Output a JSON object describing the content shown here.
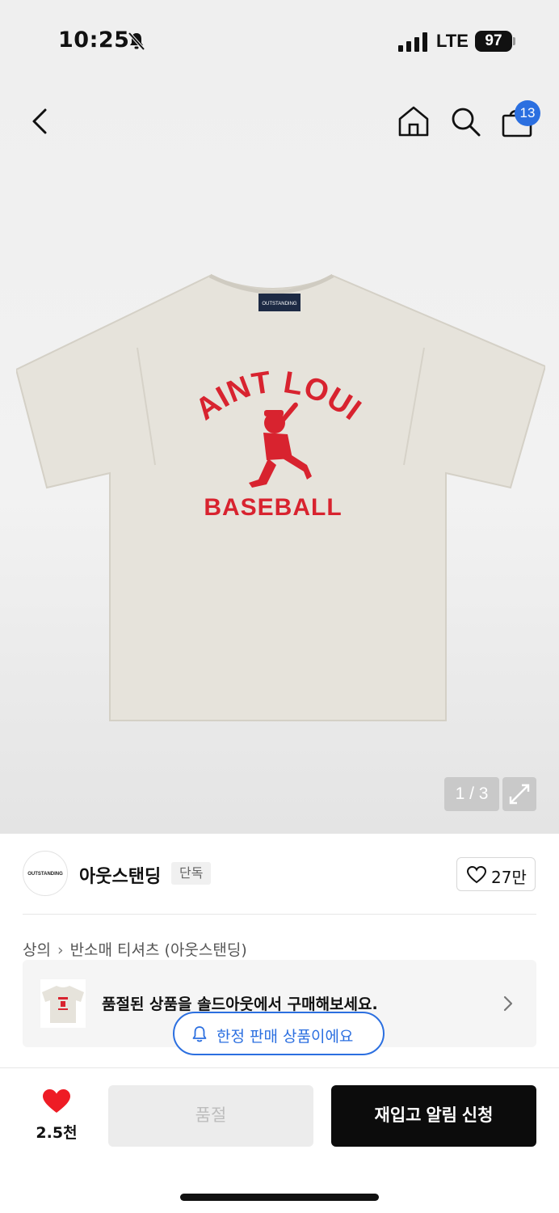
{
  "status_bar": {
    "time": "10:25",
    "network": "LTE",
    "battery": "97"
  },
  "nav": {
    "cart_count": "13"
  },
  "product_image": {
    "print_top": "SAINT LOUIS",
    "print_bottom": "BASEBALL",
    "label_text": "OUTSTANDING",
    "shirt_color": "#e6e3db",
    "print_color": "#d8232f"
  },
  "gallery": {
    "counter": "1 / 3"
  },
  "brand": {
    "logo_text": "OUTSTANDING",
    "name": "아웃스탠딩",
    "tag": "단독",
    "likes": "27만"
  },
  "breadcrumb": {
    "items": [
      "상의",
      "반소매 티셔츠 (아웃스탠딩)"
    ]
  },
  "soldout_banner": {
    "text": "품절된 상품을 솔드아웃에서 구매해보세요."
  },
  "limited_notice": {
    "text": "한정 판매 상품이에요"
  },
  "bottom_bar": {
    "favorites": "2.5천",
    "soldout_label": "품절",
    "restock_label": "재입고 알림 신청"
  },
  "colors": {
    "accent_blue": "#2b6fe0",
    "heart_red": "#ee1c25",
    "button_black": "#0c0c0c"
  }
}
